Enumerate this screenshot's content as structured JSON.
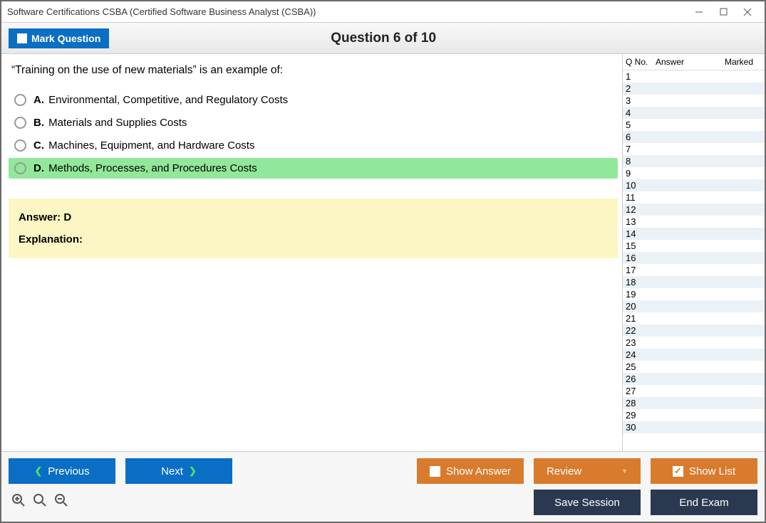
{
  "title": "Software Certifications CSBA (Certified Software Business Analyst (CSBA))",
  "header": {
    "mark_label": "Mark Question",
    "question_title": "Question 6 of 10"
  },
  "question": {
    "prompt": "“Training on the use of new materials” is an example of:",
    "options": [
      {
        "letter": "A.",
        "text": "Environmental, Competitive, and Regulatory Costs",
        "selected": false
      },
      {
        "letter": "B.",
        "text": "Materials and Supplies Costs",
        "selected": false
      },
      {
        "letter": "C.",
        "text": "Machines, Equipment, and Hardware Costs",
        "selected": false
      },
      {
        "letter": "D.",
        "text": "Methods, Processes, and Procedures Costs",
        "selected": true
      }
    ],
    "answer_label": "Answer: D",
    "explanation_label": "Explanation:"
  },
  "side": {
    "headers": {
      "qno": "Q No.",
      "answer": "Answer",
      "marked": "Marked"
    },
    "rows": [
      1,
      2,
      3,
      4,
      5,
      6,
      7,
      8,
      9,
      10,
      11,
      12,
      13,
      14,
      15,
      16,
      17,
      18,
      19,
      20,
      21,
      22,
      23,
      24,
      25,
      26,
      27,
      28,
      29,
      30
    ]
  },
  "footer": {
    "previous": "Previous",
    "next": "Next",
    "show_answer": "Show Answer",
    "review": "Review",
    "show_list": "Show List",
    "save_session": "Save Session",
    "end_exam": "End Exam"
  }
}
